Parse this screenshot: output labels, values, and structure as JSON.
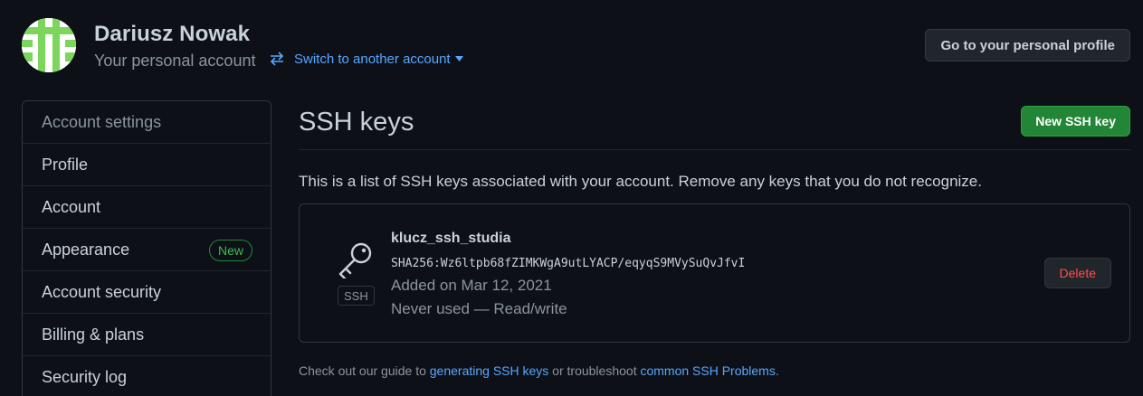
{
  "header": {
    "user_name": "Dariusz Nowak",
    "subtitle": "Your personal account",
    "switch_label": "Switch to another account",
    "profile_button": "Go to your personal profile"
  },
  "sidebar": {
    "heading": "Account settings",
    "items": [
      {
        "label": "Profile"
      },
      {
        "label": "Account"
      },
      {
        "label": "Appearance",
        "badge": "New"
      },
      {
        "label": "Account security"
      },
      {
        "label": "Billing & plans"
      },
      {
        "label": "Security log"
      }
    ]
  },
  "main": {
    "title": "SSH keys",
    "new_button": "New SSH key",
    "description": "This is a list of SSH keys associated with your account. Remove any keys that you do not recognize.",
    "key": {
      "name": "klucz_ssh_studia",
      "fingerprint": "SHA256:Wz6ltpb68fZIMKWgA9utLYACP/eqyqS9MVySuQvJfvI",
      "added": "Added on Mar 12, 2021",
      "usage": "Never used — Read/write",
      "type_tag": "SSH",
      "delete_label": "Delete"
    },
    "footer": {
      "prefix": "Check out our guide to ",
      "link1": "generating SSH keys",
      "middle": " or troubleshoot ",
      "link2": "common SSH Problems",
      "suffix": "."
    }
  },
  "colors": {
    "background": "#0d1117",
    "accent_link": "#58a6ff",
    "primary_button": "#238636",
    "danger": "#f85149",
    "avatar_green": "#7bd65b"
  },
  "icons": [
    "avatar-identicon",
    "switch-arrows-icon",
    "caret-down-icon",
    "key-icon"
  ]
}
